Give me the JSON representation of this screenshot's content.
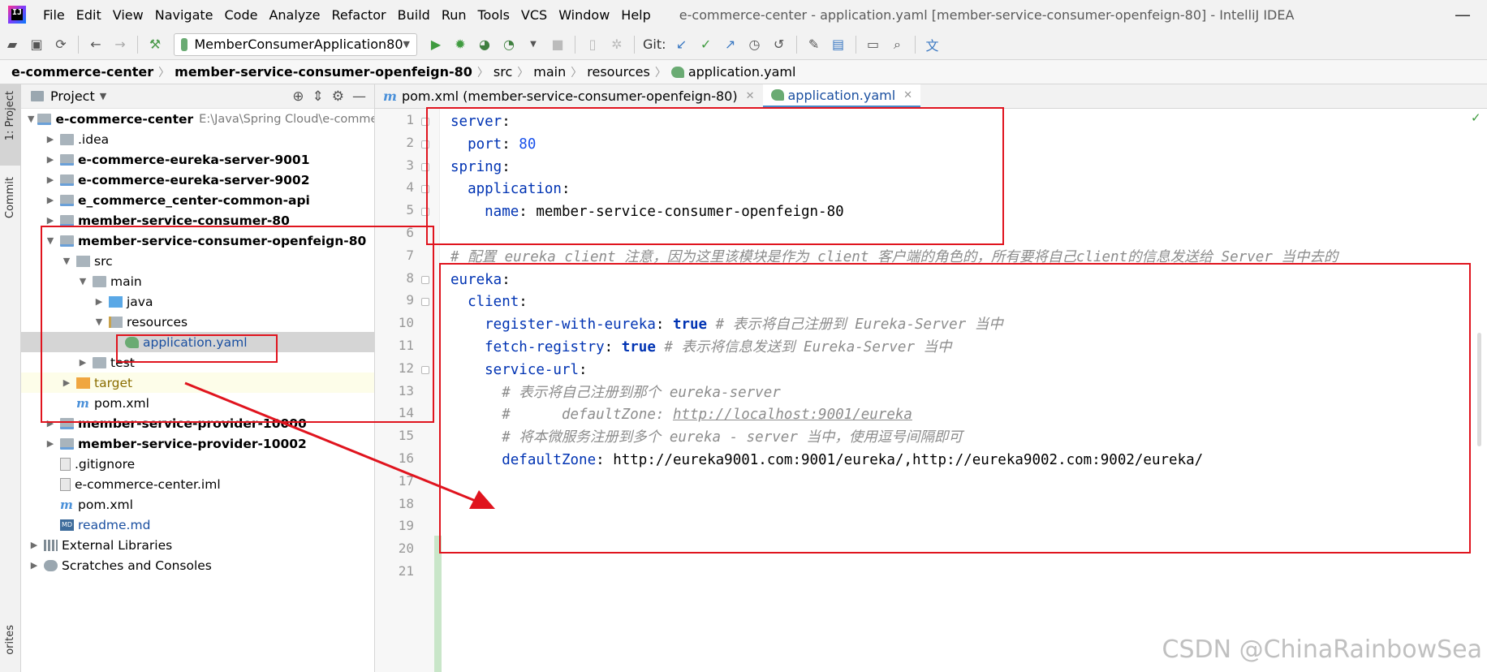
{
  "app": {
    "logo_text": "IJ",
    "window_title": "e-commerce-center - application.yaml [member-service-consumer-openfeign-80] - IntelliJ IDEA",
    "minimize": "—"
  },
  "menu": [
    "File",
    "Edit",
    "View",
    "Navigate",
    "Code",
    "Analyze",
    "Refactor",
    "Build",
    "Run",
    "Tools",
    "VCS",
    "Window",
    "Help"
  ],
  "toolbar": {
    "run_config": "MemberConsumerApplication80",
    "git_label": "Git:"
  },
  "breadcrumb": [
    "e-commerce-center",
    "member-service-consumer-openfeign-80",
    "src",
    "main",
    "resources",
    "application.yaml"
  ],
  "side_strip": {
    "project_label": "1: Project",
    "commit_label": "Commit",
    "favorites_label": "orites"
  },
  "project_panel": {
    "title": "Project",
    "tree": [
      {
        "depth": 0,
        "arrow": "▼",
        "icon": "module",
        "label": "e-commerce-center",
        "bold": true,
        "extra": "E:\\Java\\Spring Cloud\\e-comme"
      },
      {
        "depth": 1,
        "arrow": "▶",
        "icon": "folder",
        "label": ".idea"
      },
      {
        "depth": 1,
        "arrow": "▶",
        "icon": "module",
        "label": "e-commerce-eureka-server-9001",
        "bold": true
      },
      {
        "depth": 1,
        "arrow": "▶",
        "icon": "module",
        "label": "e-commerce-eureka-server-9002",
        "bold": true
      },
      {
        "depth": 1,
        "arrow": "▶",
        "icon": "module",
        "label": "e_commerce_center-common-api",
        "bold": true
      },
      {
        "depth": 1,
        "arrow": "▶",
        "icon": "module",
        "label": "member-service-consumer-80",
        "bold": true
      },
      {
        "depth": 1,
        "arrow": "▼",
        "icon": "module",
        "label": "member-service-consumer-openfeign-80",
        "bold": true
      },
      {
        "depth": 2,
        "arrow": "▼",
        "icon": "src",
        "label": "src"
      },
      {
        "depth": 3,
        "arrow": "▼",
        "icon": "folder",
        "label": "main"
      },
      {
        "depth": 4,
        "arrow": "▶",
        "icon": "blue",
        "label": "java"
      },
      {
        "depth": 4,
        "arrow": "▼",
        "icon": "res",
        "label": "resources"
      },
      {
        "depth": 5,
        "arrow": "",
        "icon": "yaml",
        "label": "application.yaml",
        "selected": true,
        "blue": true
      },
      {
        "depth": 3,
        "arrow": "▶",
        "icon": "folder",
        "label": "test"
      },
      {
        "depth": 2,
        "arrow": "▶",
        "icon": "orange",
        "label": "target",
        "highlight": true,
        "orange": true
      },
      {
        "depth": 2,
        "arrow": "",
        "icon": "maven",
        "label": "pom.xml"
      },
      {
        "depth": 1,
        "arrow": "▶",
        "icon": "module",
        "label": "member-service-provider-10000",
        "bold": true
      },
      {
        "depth": 1,
        "arrow": "▶",
        "icon": "module",
        "label": "member-service-provider-10002",
        "bold": true
      },
      {
        "depth": 1,
        "arrow": "",
        "icon": "file",
        "label": ".gitignore"
      },
      {
        "depth": 1,
        "arrow": "",
        "icon": "file",
        "label": "e-commerce-center.iml"
      },
      {
        "depth": 1,
        "arrow": "",
        "icon": "maven",
        "label": "pom.xml"
      },
      {
        "depth": 1,
        "arrow": "",
        "icon": "md",
        "label": "readme.md",
        "blue": true
      },
      {
        "depth": 0,
        "arrow": "▶",
        "icon": "libs",
        "label": "External Libraries"
      },
      {
        "depth": 0,
        "arrow": "▶",
        "icon": "scratch",
        "label": "Scratches and Consoles"
      }
    ]
  },
  "editor_tabs": [
    {
      "label": "pom.xml (member-service-consumer-openfeign-80)",
      "icon": "m",
      "active": false
    },
    {
      "label": "application.yaml",
      "icon": "yaml",
      "active": true
    }
  ],
  "code_lines": [
    [
      {
        "t": "server",
        "s": "k"
      },
      {
        "t": ":",
        "s": "v"
      }
    ],
    [
      {
        "t": "  port",
        "s": "k"
      },
      {
        "t": ": ",
        "s": "v"
      },
      {
        "t": "80",
        "s": "num"
      }
    ],
    [
      {
        "t": "spring",
        "s": "k"
      },
      {
        "t": ":",
        "s": "v"
      }
    ],
    [
      {
        "t": "  application",
        "s": "k"
      },
      {
        "t": ":",
        "s": "v"
      }
    ],
    [
      {
        "t": "    name",
        "s": "k"
      },
      {
        "t": ": member-service-consumer-openfeign-80",
        "s": "v"
      }
    ],
    [],
    [
      {
        "t": "# 配置 eureka client 注意，因为这里该模块是作为 client 客户端的角色的，所有要将自己client的信息发送给 Server 当中去的",
        "s": "c"
      }
    ],
    [
      {
        "t": "eureka",
        "s": "k"
      },
      {
        "t": ":",
        "s": "v"
      }
    ],
    [
      {
        "t": "  client",
        "s": "k"
      },
      {
        "t": ":",
        "s": "v"
      }
    ],
    [
      {
        "t": "    register-with-eureka",
        "s": "k"
      },
      {
        "t": ": ",
        "s": "v"
      },
      {
        "t": "true",
        "s": "kw"
      },
      {
        "t": " # 表示将自己注册到 Eureka-Server 当中",
        "s": "c"
      }
    ],
    [
      {
        "t": "    fetch-registry",
        "s": "k"
      },
      {
        "t": ": ",
        "s": "v"
      },
      {
        "t": "true",
        "s": "kw"
      },
      {
        "t": " # 表示将信息发送到 Eureka-Server 当中",
        "s": "c"
      }
    ],
    [
      {
        "t": "    service-url",
        "s": "k"
      },
      {
        "t": ":",
        "s": "v"
      }
    ],
    [
      {
        "t": "      # 表示将自己注册到那个 eureka-server",
        "s": "c"
      }
    ],
    [
      {
        "t": "      #      defaultZone: ",
        "s": "c"
      },
      {
        "t": "http://localhost:9001/eureka",
        "s": "cu"
      }
    ],
    [
      {
        "t": "      # 将本微服务注册到多个 eureka - server 当中，使用逗号间隔即可",
        "s": "c"
      }
    ],
    [
      {
        "t": "      defaultZone",
        "s": "k"
      },
      {
        "t": ": http://eureka9001.com:9001/eureka/,http://eureka9002.com:9002/eureka/",
        "s": "v"
      }
    ],
    [],
    [],
    [],
    [],
    []
  ],
  "line_numbers": [
    "1",
    "2",
    "3",
    "4",
    "5",
    "6",
    "7",
    "8",
    "9",
    "10",
    "11",
    "12",
    "13",
    "14",
    "15",
    "16",
    "17",
    "18",
    "19",
    "20",
    "21"
  ],
  "ok_mark": "✓",
  "watermark": "CSDN @ChinaRainbowSea",
  "colors": {
    "accent": "#4a88c7",
    "annotation": "#e0141e"
  }
}
